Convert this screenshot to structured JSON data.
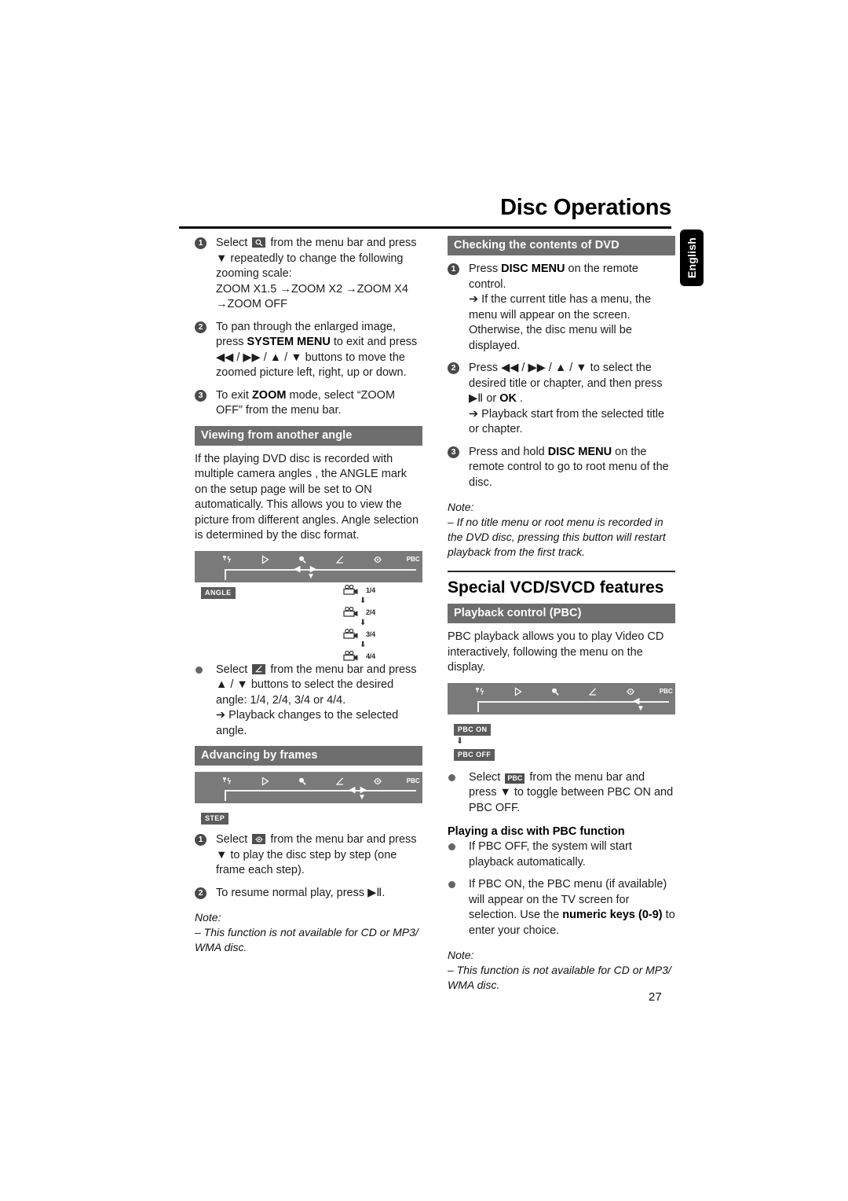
{
  "header": {
    "title": "Disc Operations",
    "language_tab": "English"
  },
  "folio": "27",
  "left_column": {
    "zoom_steps": [
      {
        "num": "1",
        "text_before_icon": "Select",
        "icon": "zoom-magnifier-icon",
        "text_after_icon": "from the menu bar and press ▼ repeatedly to change the following zooming scale:",
        "scale_line1": "ZOOM X1.5 →ZOOM X2 →ZOOM X4",
        "scale_line2": "→ZOOM OFF"
      },
      {
        "num": "2",
        "part1": "To pan through the enlarged image, press",
        "bold1": "SYSTEM MENU",
        "part2": "to exit and press ◀◀ / ▶▶ / ▲ / ▼ buttons to move the zoomed picture left, right, up or down."
      },
      {
        "num": "3",
        "part1": "To exit",
        "bold1": "ZOOM",
        "part2": "mode, select “ZOOM OFF” from the menu bar."
      }
    ],
    "viewing_angle": {
      "heading": "Viewing from another angle",
      "body": "If the playing DVD disc is recorded with multiple camera angles , the ANGLE mark on the setup page will be set to ON automatically. This allows you to view the picture from different angles. Angle selection is determined by the disc format.",
      "osd_icons": [
        "tools-icon",
        "play-icon",
        "zoom-magnifier-icon",
        "angle-icon",
        "step-icon",
        "PBC"
      ],
      "osd_chip": "ANGLE",
      "camera_steps": [
        "1/4",
        "2/4",
        "3/4",
        "4/4"
      ],
      "bullet": {
        "text_before_icon": "Select",
        "icon": "angle-icon",
        "text_after_icon": "from the menu bar and press ▲ / ▼ buttons to select the desired angle: 1/4, 2/4, 3/4 or 4/4.",
        "arrow_line": "➔ Playback changes to the selected angle."
      }
    },
    "advancing_frames": {
      "heading": "Advancing by frames",
      "osd_icons": [
        "tools-icon",
        "play-icon",
        "zoom-magnifier-icon",
        "angle-icon",
        "step-icon",
        "PBC"
      ],
      "osd_chip": "STEP",
      "steps": [
        {
          "num": "1",
          "text_before_icon": "Select",
          "icon": "step-icon",
          "text_after_icon": "from the menu bar and press ▼ to play the disc step by step (one frame each step)."
        },
        {
          "num": "2",
          "text": "To resume normal play, press ▶Ⅱ."
        }
      ]
    },
    "note": {
      "label": "Note:",
      "text": "–  This function is not available for CD or MP3/ WMA disc."
    }
  },
  "right_column": {
    "checking_dvd": {
      "heading": "Checking the contents of DVD",
      "steps": [
        {
          "num": "1",
          "part1": "Press",
          "bold1": "DISC MENU",
          "part2": "on the remote control.",
          "arrow": "➔ If the current title has a menu, the menu will appear on the screen.  Otherwise, the disc menu will be displayed."
        },
        {
          "num": "2",
          "part1": "Press ◀◀ / ▶▶ / ▲ / ▼ to select the desired title or chapter, and then press ▶Ⅱ or",
          "bold1": "OK",
          "part2": ".",
          "arrow": "➔ Playback start from the selected title or chapter."
        },
        {
          "num": "3",
          "part1": "Press and hold",
          "bold1": "DISC MENU",
          "part2": "on the remote control to go to root menu of the disc."
        }
      ],
      "note": {
        "label": "Note:",
        "text": "–  If no title menu or root menu is recorded in the DVD disc, pressing this button will restart playback from the first track."
      }
    },
    "special_features": {
      "heading": "Special VCD/SVCD features",
      "pbc": {
        "heading": "Playback  control (PBC)",
        "body": "PBC playback allows you to play Video CD interactively, following the menu on the display.",
        "osd_icons": [
          "tools-icon",
          "play-icon",
          "zoom-magnifier-icon",
          "angle-icon",
          "step-icon",
          "PBC"
        ],
        "chip_on": "PBC ON",
        "chip_off": "PBC OFF",
        "bullet": {
          "text_before_icon": "Select",
          "icon": "pbc-icon",
          "text_after_icon": "from the menu bar and press ▼ to toggle between PBC ON and PBC OFF."
        }
      },
      "playing_pbc": {
        "heading": "Playing a disc with PBC function",
        "bullets": [
          {
            "text": "If PBC OFF, the system will start playback automatically."
          },
          {
            "part1": "If PBC ON, the PBC menu (if available) will appear on the TV screen for selection. Use the",
            "bold1": "numeric keys (0-9)",
            "part2": "to enter your choice."
          }
        ]
      },
      "note": {
        "label": "Note:",
        "text": "–  This function is not available for CD or MP3/ WMA disc."
      }
    }
  }
}
